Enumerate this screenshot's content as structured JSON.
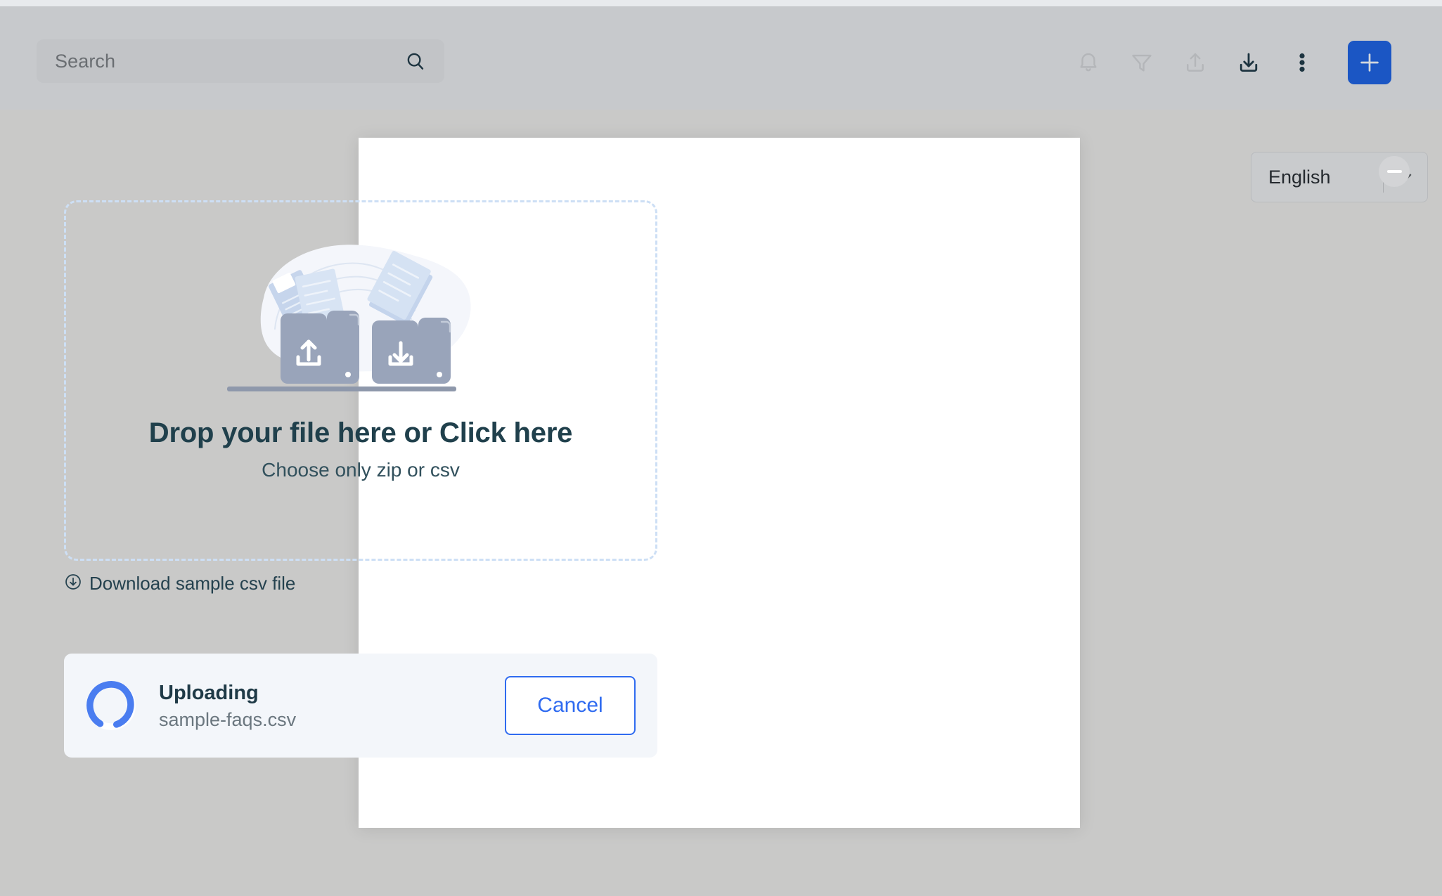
{
  "header": {
    "search": {
      "placeholder": "Search",
      "value": "",
      "icon": "search-icon"
    },
    "icons": [
      {
        "name": "notification-bell-icon",
        "state": "muted"
      },
      {
        "name": "filter-funnel-icon",
        "state": "muted"
      },
      {
        "name": "upload-icon",
        "state": "muted"
      },
      {
        "name": "download-icon",
        "state": "active"
      },
      {
        "name": "more-vertical-icon",
        "state": "active"
      }
    ],
    "add_button": {
      "name": "add-button",
      "icon": "plus-icon"
    }
  },
  "language_selector": {
    "value": "English",
    "caret_icon": "chevron-down-icon"
  },
  "modal": {
    "minimize_button_icon": "minus-icon",
    "dropzone": {
      "illustration": "file-transfer-illustration",
      "title": "Drop your file here or Click here",
      "subtitle": "Choose only zip or csv"
    },
    "sample_link": {
      "icon": "download-circle-icon",
      "label": "Download sample csv file"
    },
    "upload_status": {
      "spinner_icon": "loading-spinner-icon",
      "state": "Uploading",
      "filename": "sample-faqs.csv",
      "cancel_label": "Cancel"
    }
  },
  "colors": {
    "accent_blue": "#1b56c4",
    "link_blue": "#2f6bf0",
    "page_background": "#c9c9c8",
    "header_background": "#c7c9cc",
    "modal_background": "#ffffff",
    "dropzone_border": "#cddff5",
    "upload_card_background": "#f3f6fa",
    "heading_text": "#20404c"
  }
}
